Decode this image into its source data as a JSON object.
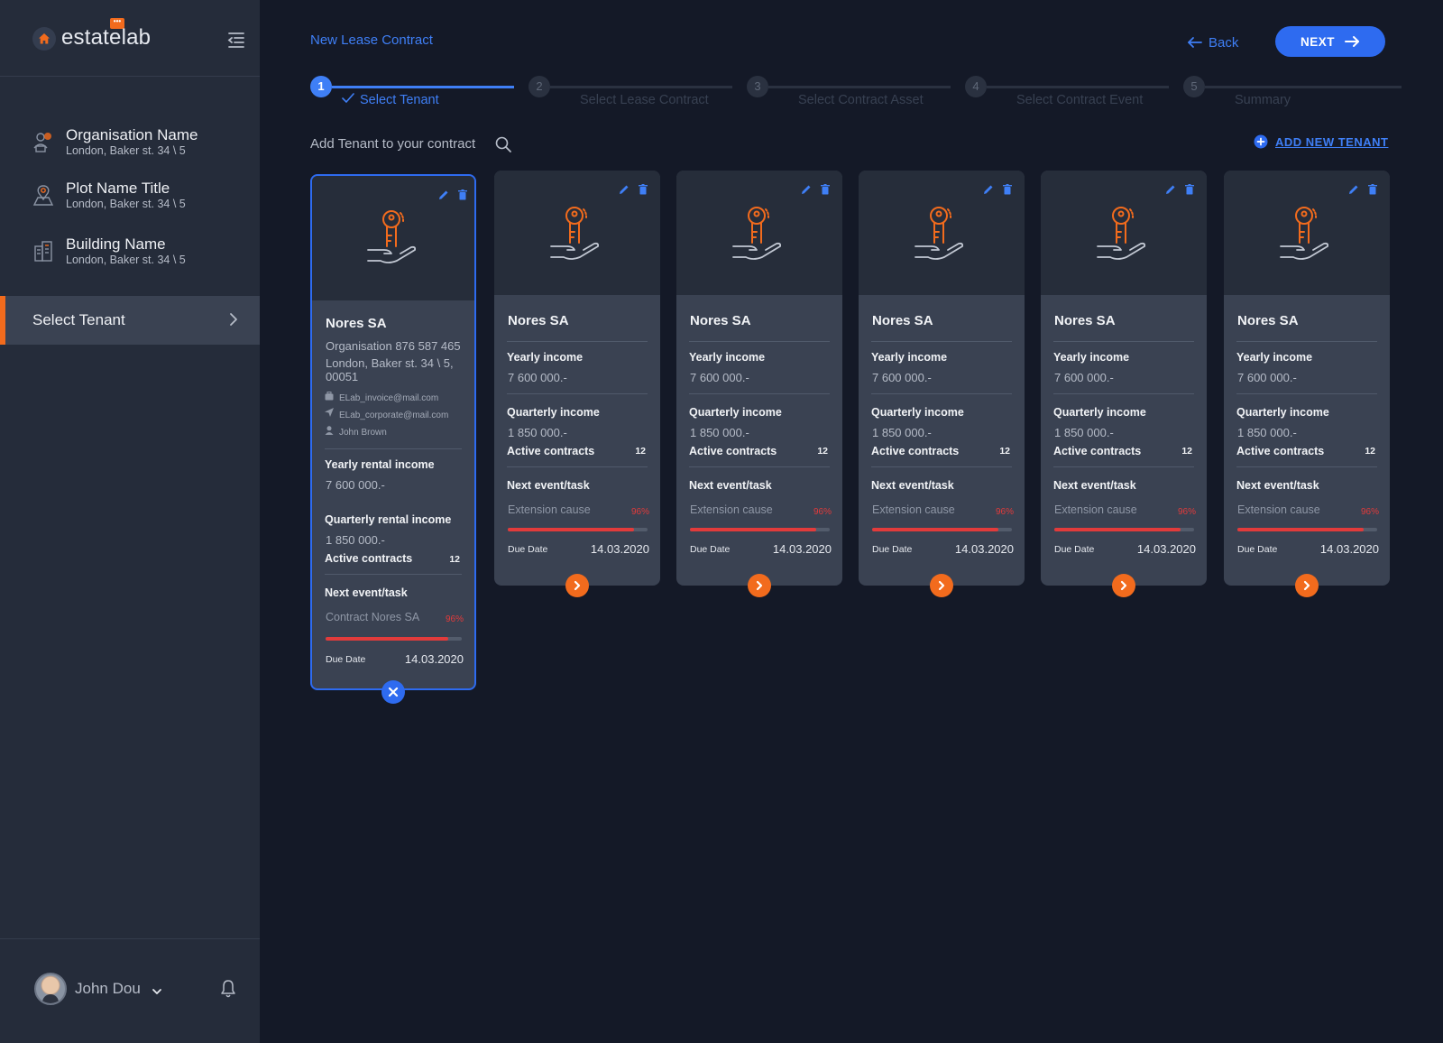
{
  "app": {
    "logo_text": "estatelab",
    "logo_badge": "•••"
  },
  "colors": {
    "accent_blue": "#3f7ff6",
    "accent_orange": "#f26b1d",
    "danger": "#e23b3b"
  },
  "sidebar": {
    "items": [
      {
        "title": "Organisation Name",
        "subtitle": "London, Baker st. 34 \\ 5",
        "icon": "organisation-icon"
      },
      {
        "title": "Plot Name Title",
        "subtitle": "London, Baker st. 34 \\ 5",
        "icon": "map-pin-icon"
      },
      {
        "title": "Building Name",
        "subtitle": "London, Baker st. 34 \\ 5",
        "icon": "building-icon"
      }
    ],
    "active_item": "Select Tenant",
    "user": {
      "name": "John Dou"
    }
  },
  "header": {
    "title": "New Lease Contract",
    "back_label": "Back",
    "next_label": "NEXT"
  },
  "stepper": [
    {
      "num": "1",
      "label": "Select Tenant",
      "active": true
    },
    {
      "num": "2",
      "label": "Select Lease Contract",
      "active": false
    },
    {
      "num": "3",
      "label": "Select Contract Asset",
      "active": false
    },
    {
      "num": "4",
      "label": "Select Contract Event",
      "active": false
    },
    {
      "num": "5",
      "label": "Summary",
      "active": false
    }
  ],
  "search": {
    "label": "Add Tenant to your contract"
  },
  "add_new_tenant_label": "ADD NEW TENANT",
  "selected_card": {
    "name": "Nores SA",
    "org_line": "Organisation 876 587 465",
    "address_line1": "London, Baker st. 34 \\ 5,",
    "address_line2": "00051",
    "invoice_email": "ELab_invoice@mail.com",
    "corporate_email": "ELab_corporate@mail.com",
    "contact": "John Brown",
    "yearly_label": "Yearly rental income",
    "yearly_value": "7 600 000.-",
    "quarterly_label": "Quarterly rental income",
    "quarterly_value": "1 850 000.-",
    "active_label": "Active contracts",
    "active_count": "12",
    "next_label": "Next event/task",
    "event_name": "Contract Nores SA",
    "event_pct": "96%",
    "progress": 0.9,
    "due_label": "Due Date",
    "due_date": "14.03.2020"
  },
  "cards": [
    {
      "name": "Nores SA",
      "yearly_label": "Yearly income",
      "yearly_value": "7 600 000.-",
      "quarterly_label": "Quarterly income",
      "quarterly_value": "1 850 000.-",
      "active_label": "Active contracts",
      "active_count": "12",
      "next_label": "Next event/task",
      "event_name": "Extension cause",
      "event_pct": "96%",
      "progress": 0.9,
      "due_label": "Due Date",
      "due_date": "14.03.2020"
    },
    {
      "name": "Nores SA",
      "yearly_label": "Yearly income",
      "yearly_value": "7 600 000.-",
      "quarterly_label": "Quarterly income",
      "quarterly_value": "1 850 000.-",
      "active_label": "Active contracts",
      "active_count": "12",
      "next_label": "Next event/task",
      "event_name": "Extension cause",
      "event_pct": "96%",
      "progress": 0.9,
      "due_label": "Due Date",
      "due_date": "14.03.2020"
    },
    {
      "name": "Nores SA",
      "yearly_label": "Yearly income",
      "yearly_value": "7 600 000.-",
      "quarterly_label": "Quarterly income",
      "quarterly_value": "1 850 000.-",
      "active_label": "Active contracts",
      "active_count": "12",
      "next_label": "Next event/task",
      "event_name": "Extension cause",
      "event_pct": "96%",
      "progress": 0.9,
      "due_label": "Due Date",
      "due_date": "14.03.2020"
    },
    {
      "name": "Nores SA",
      "yearly_label": "Yearly income",
      "yearly_value": "7 600 000.-",
      "quarterly_label": "Quarterly income",
      "quarterly_value": "1 850 000.-",
      "active_label": "Active contracts",
      "active_count": "12",
      "next_label": "Next event/task",
      "event_name": "Extension cause",
      "event_pct": "96%",
      "progress": 0.9,
      "due_label": "Due Date",
      "due_date": "14.03.2020"
    },
    {
      "name": "Nores SA",
      "yearly_label": "Yearly income",
      "yearly_value": "7 600 000.-",
      "quarterly_label": "Quarterly income",
      "quarterly_value": "1 850 000.-",
      "active_label": "Active contracts",
      "active_count": "12",
      "next_label": "Next event/task",
      "event_name": "Extension cause",
      "event_pct": "96%",
      "progress": 0.9,
      "due_label": "Due Date",
      "due_date": "14.03.2020"
    }
  ]
}
